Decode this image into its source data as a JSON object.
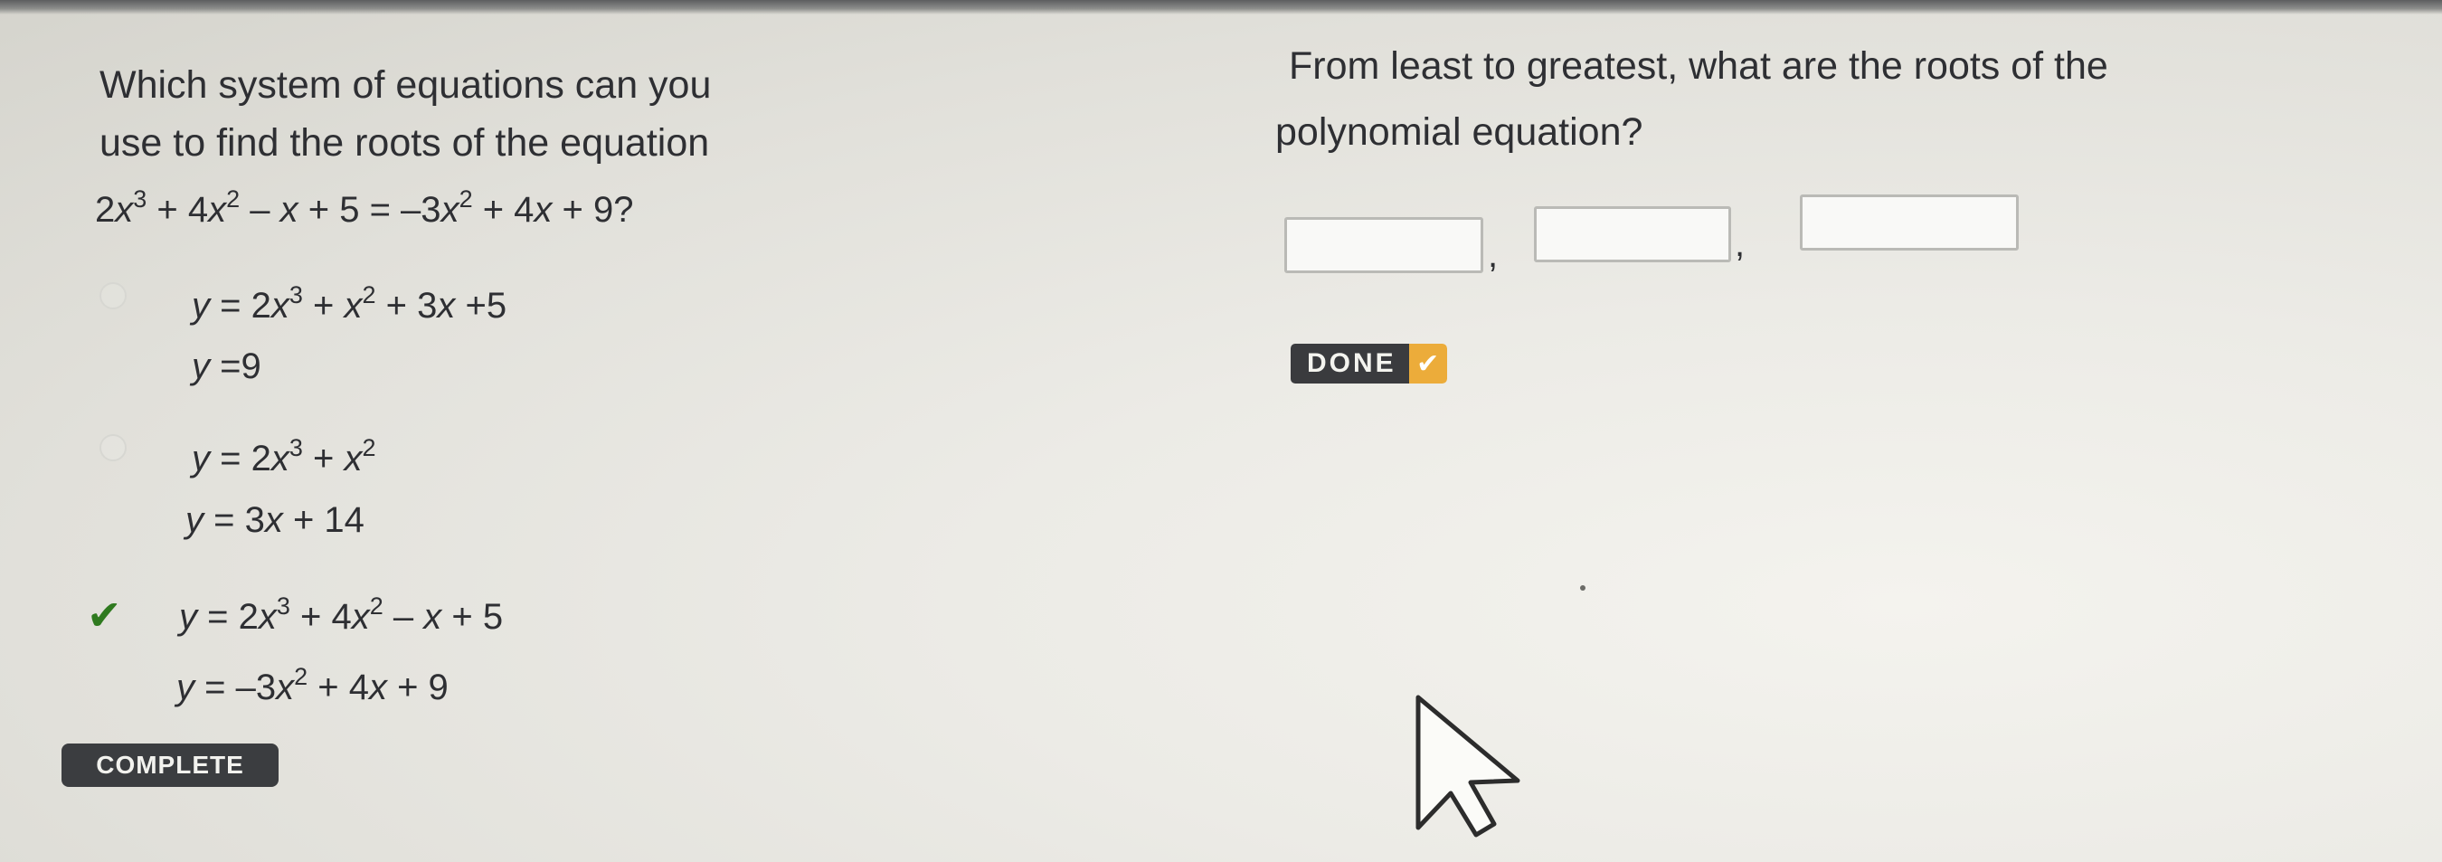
{
  "question1": {
    "prompt_line1": "Which system of equations can you",
    "prompt_line2": "use to find the roots of the equation",
    "equation": "2x³ + 4x² – x + 5 = –3x² + 4x + 9?",
    "options": [
      {
        "line1": "y = 2x³ + x² + 3x +5",
        "line2": "y =9",
        "selected": false
      },
      {
        "line1": "y = 2x³ + x²",
        "line2": "y = 3x + 14",
        "selected": false
      },
      {
        "line1": "y = 2x³ + 4x² – x + 5",
        "line2": "y = –3x² + 4x + 9",
        "selected": true
      }
    ],
    "status_badge": "COMPLETE",
    "check_icon": "checkmark-icon"
  },
  "question2": {
    "prompt_line1": "From least to greatest, what are the roots of the",
    "prompt_line2": "polynomial equation?",
    "separator": ",",
    "answers": [
      "",
      "",
      ""
    ],
    "done_label": "DONE",
    "done_icon": "check-icon"
  },
  "colors": {
    "text": "#2e2f33",
    "correct_check": "#2f7a1f",
    "badge_bg": "#3b3d40",
    "done_accent": "#ecac3a"
  }
}
